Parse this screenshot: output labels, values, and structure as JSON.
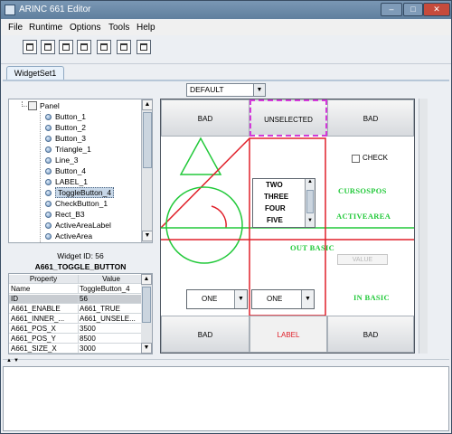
{
  "window": {
    "title": "ARINC 661 Editor",
    "controls": [
      "–",
      "□",
      "✕"
    ]
  },
  "menubar": {
    "items": [
      "File",
      "Runtime",
      "Options",
      "Tools",
      "Help"
    ]
  },
  "toolbar": {
    "buttons": [
      "new-layer-icon",
      "align-left-icon",
      "align-center-icon",
      "align-top-icon",
      "align-bottom-icon",
      "distribute-horizontal-icon",
      "distribute-vertical-icon"
    ]
  },
  "tabs": {
    "active": "WidgetSet1"
  },
  "layer_select": {
    "value": "DEFAULT",
    "arrow": "▼"
  },
  "tree": {
    "root": "Panel",
    "items": [
      "Button_1",
      "Button_2",
      "Button_3",
      "Triangle_1",
      "Line_3",
      "Button_4",
      "LABEL_1",
      "ToggleButton_4",
      "CheckButton_1",
      "Rect_B3",
      "ActiveAreaLabel",
      "ActiveArea"
    ],
    "selected": "ToggleButton_4"
  },
  "props": {
    "widget_id": "Widget ID: 56",
    "widget_type": "A661_TOGGLE_BUTTON",
    "columns": [
      "Property",
      "Value"
    ],
    "rows": [
      [
        "Name",
        "ToggleButton_4"
      ],
      [
        "ID",
        "56"
      ],
      [
        "A661_ENABLE",
        "A661_TRUE"
      ],
      [
        "A661_INNER_...",
        "A661_UNSELE..."
      ],
      [
        "A661_POS_X",
        "3500"
      ],
      [
        "A661_POS_Y",
        "8500"
      ],
      [
        "A661_SIZE_X",
        "3000"
      ]
    ]
  },
  "canvas": {
    "top_buttons": [
      "BAD",
      "UNSELECTED",
      "BAD"
    ],
    "bottom_buttons": [
      "BAD",
      "LABEL",
      "BAD"
    ],
    "check_label": "CHECK",
    "list_items": [
      "TWO",
      "THREE",
      "FOUR",
      "FIVE"
    ],
    "labels": {
      "cursorpos": "CURSOSPOS",
      "activearea": "ACTIVEAREA",
      "out_basic": "OUT BASIC",
      "in_basic": "IN BASIC"
    },
    "value_field": "VALUE",
    "combo_left": "ONE",
    "combo_right": "ONE",
    "combo_arrow": "▼",
    "colors": {
      "green": "#22c93a",
      "red": "#e0202a",
      "magenta": "#d23ad8",
      "label_red": "#e0202a"
    }
  }
}
